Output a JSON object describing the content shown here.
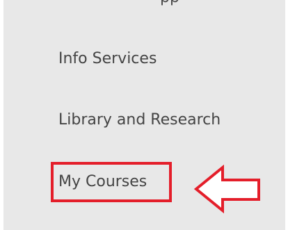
{
  "menu": {
    "partial_item_label": "pp",
    "items": [
      {
        "label": "Info Services"
      },
      {
        "label": "Library and Research"
      },
      {
        "label": "My Courses"
      }
    ]
  },
  "annotation": {
    "highlight_color": "#e41e2a",
    "arrow_icon": "arrow-left-outline-icon"
  }
}
